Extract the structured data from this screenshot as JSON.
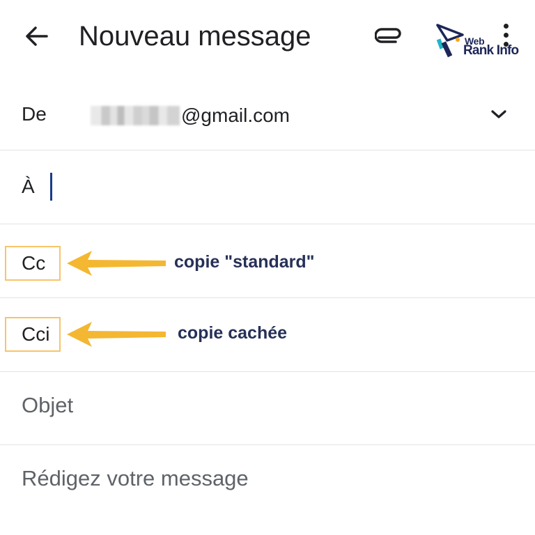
{
  "header": {
    "title": "Nouveau message",
    "back_icon": "arrow-back-icon",
    "attach_icon": "paperclip-icon",
    "more_icon": "more-vert-icon"
  },
  "logo": {
    "line1": "Web",
    "line2": "Rank Info"
  },
  "from": {
    "label": "De",
    "email_suffix": "@gmail.com",
    "dropdown_icon": "chevron-down-icon"
  },
  "to": {
    "label": "À",
    "value": ""
  },
  "cc": {
    "label": "Cc"
  },
  "cci": {
    "label": "Cci"
  },
  "annotations": {
    "cc_text": "copie \"standard\"",
    "cci_text": "copie cachée",
    "color": "#f7c46b",
    "arrow_color": "#f4b732"
  },
  "subject": {
    "placeholder": "Objet"
  },
  "body": {
    "placeholder": "Rédigez votre message"
  }
}
